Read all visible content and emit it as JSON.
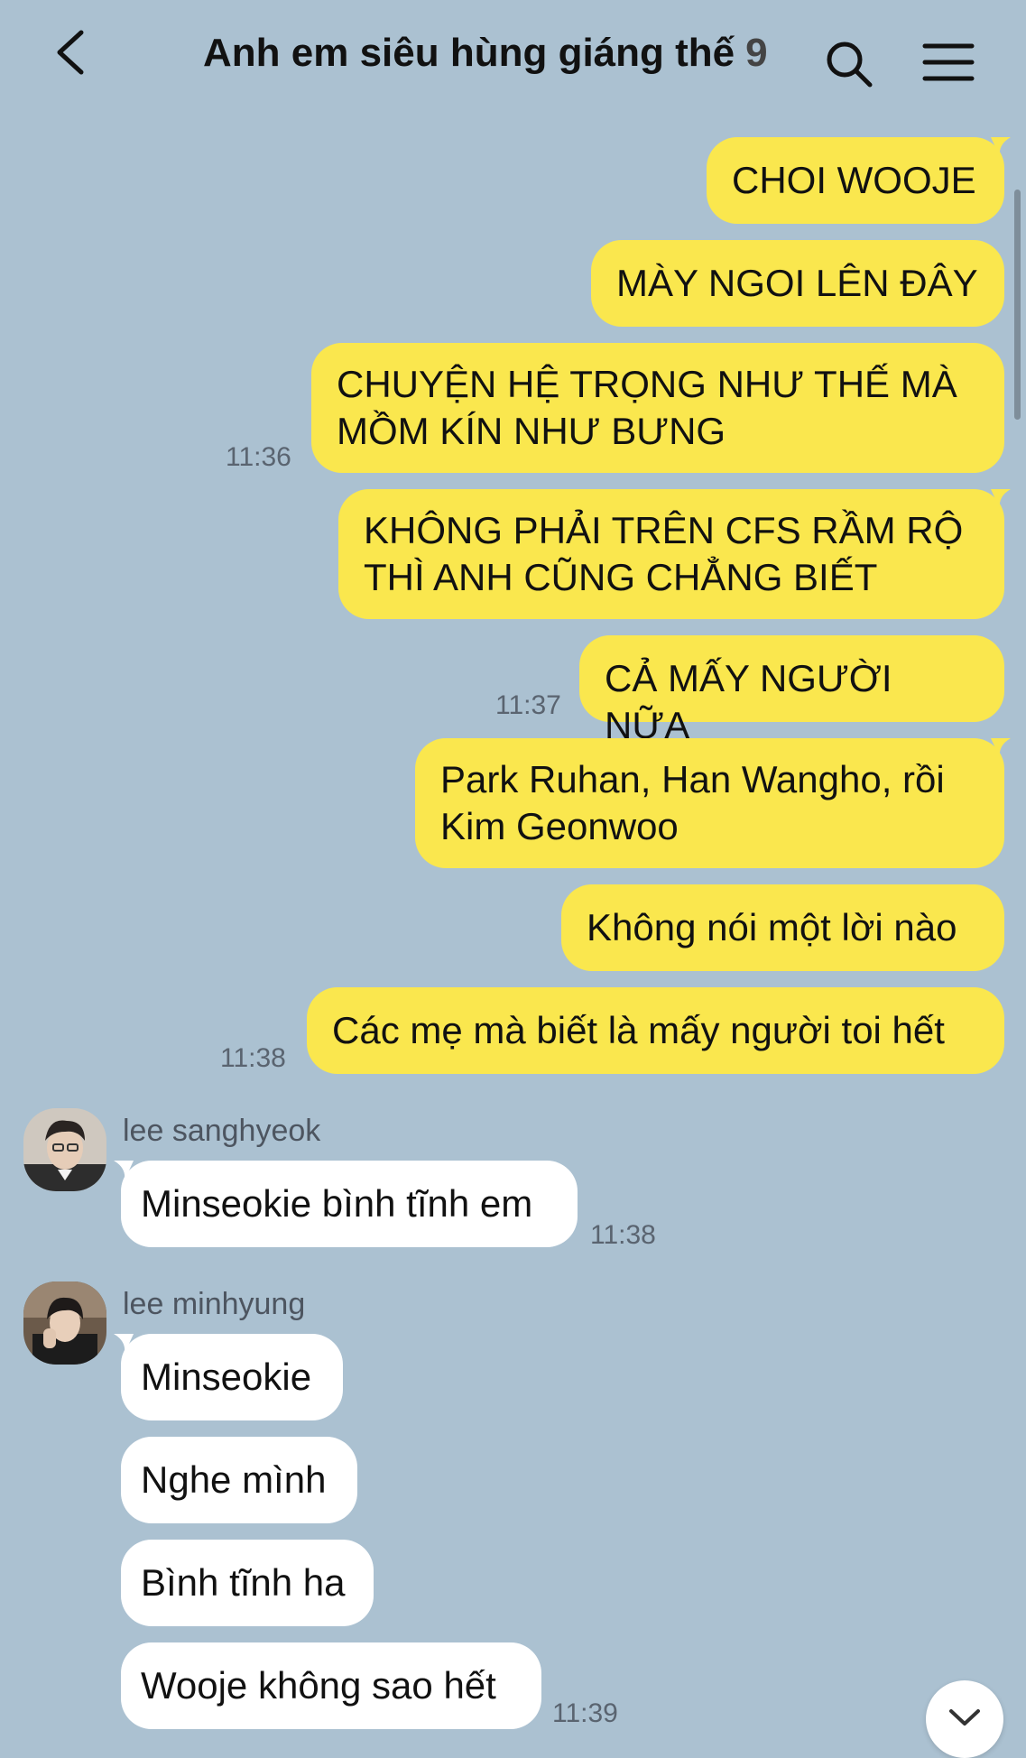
{
  "header": {
    "title": "Anh em siêu hùng giáng thế",
    "member_count": "9",
    "back_icon": "chevron-left-icon",
    "search_icon": "search-icon",
    "menu_icon": "hamburger-menu-icon"
  },
  "colors": {
    "background": "#abc1d1",
    "my_bubble": "#fae74e",
    "their_bubble": "#ffffff"
  },
  "messages_mine": [
    {
      "text": "CHOI WOOJE"
    },
    {
      "text": "MÀY NGOI LÊN ĐÂY"
    },
    {
      "text": "CHUYỆN HỆ TRỌNG NHƯ THẾ MÀ\nMỒM KÍN NHƯ BƯNG",
      "time": "11:36"
    },
    {
      "text": "KHÔNG PHẢI TRÊN CFS RẦM RỘ\nTHÌ ANH CŨNG CHẲNG BIẾT"
    },
    {
      "text": "CẢ MẤY NGƯỜI NỮA",
      "time": "11:37"
    },
    {
      "text": "Park Ruhan, Han Wangho, rồi\nKim Geonwoo"
    },
    {
      "text": "Không nói một lời nào"
    },
    {
      "text": "Các mẹ mà biết là mấy người toi hết",
      "time": "11:38"
    }
  ],
  "group1": {
    "sender": "lee sanghyeok",
    "messages": [
      {
        "text": "Minseokie bình tĩnh em",
        "time": "11:38"
      }
    ]
  },
  "group2": {
    "sender": "lee minhyung",
    "messages": [
      {
        "text": "Minseokie"
      },
      {
        "text": "Nghe mình"
      },
      {
        "text": "Bình tĩnh ha"
      },
      {
        "text": "Wooje không sao hết",
        "time": "11:39"
      }
    ]
  },
  "scroll_down_icon": "chevron-down-icon"
}
